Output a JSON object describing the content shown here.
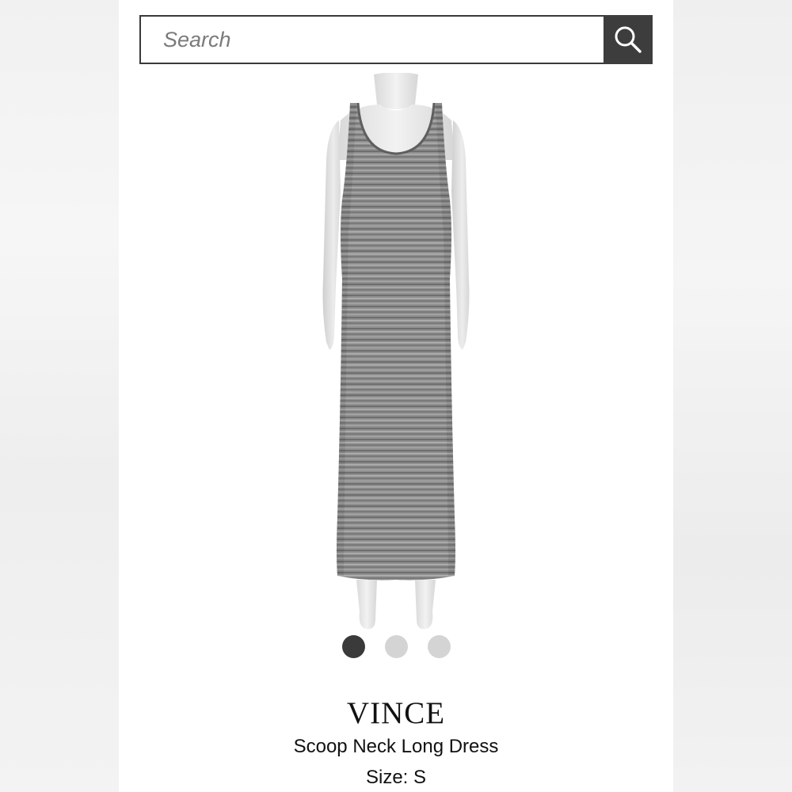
{
  "search": {
    "placeholder": "Search",
    "button_icon": "search-icon"
  },
  "gallery": {
    "image_count": 3,
    "active_index": 0,
    "dot_colors": {
      "active": "#3a3a3a",
      "inactive": "#d4d4d4"
    }
  },
  "product": {
    "brand": "VINCE",
    "name": "Scoop Neck Long Dress",
    "size": "Size: S"
  },
  "colors": {
    "panel": "#ffffff",
    "search_button": "#3d3d3d",
    "dress": "#8a8a8a",
    "mannequin": "#e8e8e8"
  }
}
